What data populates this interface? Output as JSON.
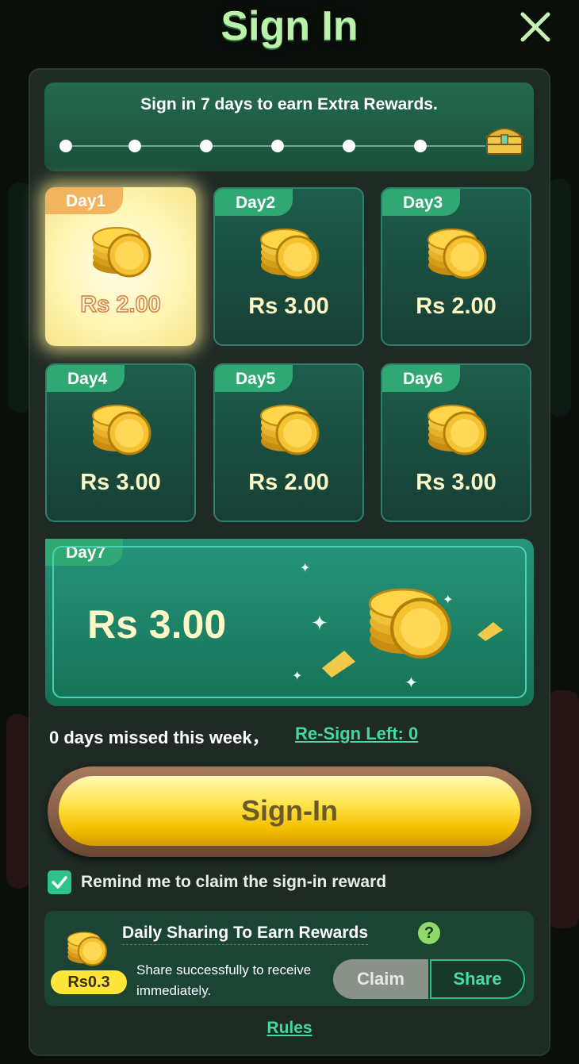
{
  "header": {
    "title": "Sign In"
  },
  "progress": {
    "text": "Sign in 7 days to earn Extra Rewards.",
    "dots": 6
  },
  "days": [
    {
      "label": "Day1",
      "amount": "Rs 2.00",
      "active": true
    },
    {
      "label": "Day2",
      "amount": "Rs 3.00",
      "active": false
    },
    {
      "label": "Day3",
      "amount": "Rs 2.00",
      "active": false
    },
    {
      "label": "Day4",
      "amount": "Rs 3.00",
      "active": false
    },
    {
      "label": "Day5",
      "amount": "Rs 2.00",
      "active": false
    },
    {
      "label": "Day6",
      "amount": "Rs 3.00",
      "active": false
    }
  ],
  "day7": {
    "label": "Day7",
    "amount": "Rs 3.00"
  },
  "status": {
    "missed": "0 days missed this week，",
    "resign": "Re-Sign Left: 0"
  },
  "signin_button": {
    "label": "Sign-In"
  },
  "remind": {
    "label": "Remind me to claim the sign-in reward",
    "checked": true
  },
  "sharing": {
    "title": "Daily Sharing To Earn Rewards",
    "badge": "Rs0.3",
    "description": "Share successfully to receive immediately.",
    "claim_label": "Claim",
    "share_label": "Share"
  },
  "footer": {
    "rules_label": "Rules"
  },
  "colors": {
    "accent": "#45d79e",
    "gold": "#ffe44d",
    "panel": "#1f2a24"
  }
}
